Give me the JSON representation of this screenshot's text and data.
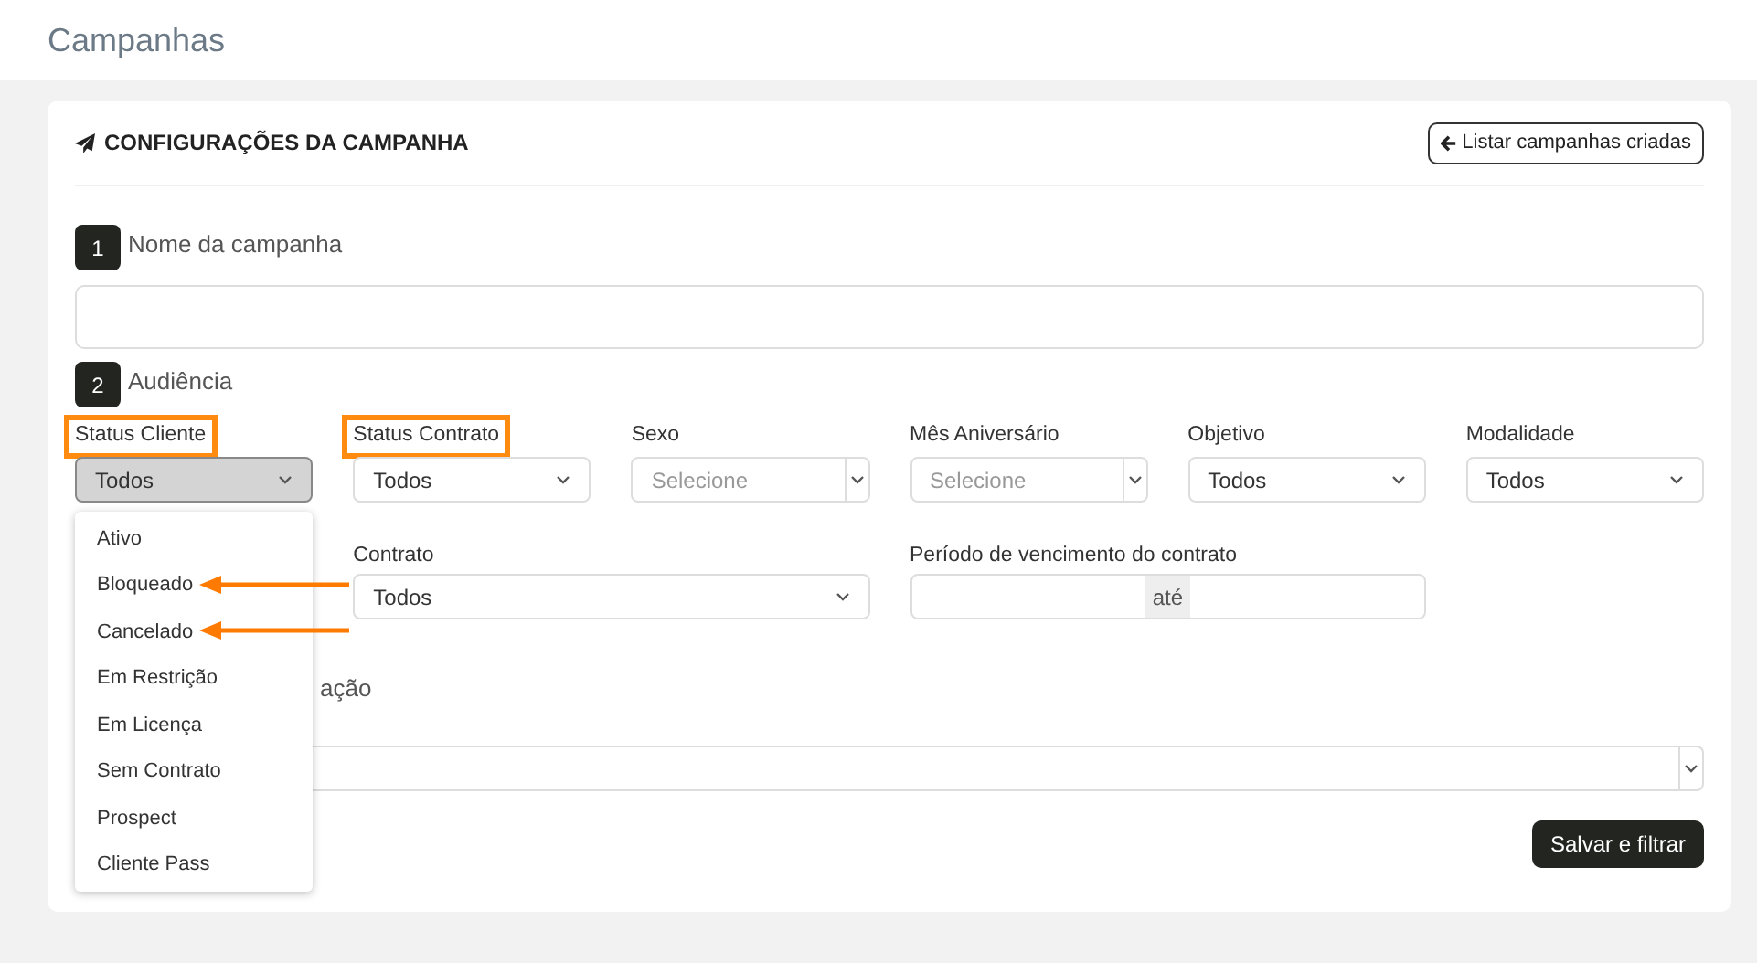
{
  "page_title": "Campanhas",
  "card": {
    "title": "CONFIGURAÇÕES DA CAMPANHA",
    "back_button": "Listar campanhas criadas",
    "step1": {
      "number": "1",
      "label": "Nome da campanha"
    },
    "step2": {
      "number": "2",
      "label": "Audiência"
    },
    "filters": [
      {
        "label": "Status Cliente",
        "kind": "select",
        "value": "Todos",
        "open": true,
        "highlighted": true
      },
      {
        "label": "Status Contrato",
        "kind": "select",
        "value": "Todos",
        "open": false,
        "highlighted": true
      },
      {
        "label": "Sexo",
        "kind": "multiselect",
        "placeholder": "Selecione",
        "open": false,
        "highlighted": false
      },
      {
        "label": "Mês Aniversário",
        "kind": "multiselect",
        "placeholder": "Selecione",
        "open": false,
        "highlighted": false
      },
      {
        "label": "Objetivo",
        "kind": "select",
        "value": "Todos",
        "open": false,
        "highlighted": false
      },
      {
        "label": "Modalidade",
        "kind": "select",
        "value": "Todos",
        "open": false,
        "highlighted": false
      }
    ],
    "filters_row2": [
      {
        "label": "Contrato",
        "kind": "select",
        "value": "Todos"
      },
      {
        "label": "Período de vencimento do contrato",
        "kind": "range",
        "separator": "até"
      }
    ],
    "step3": {
      "label_visible": "ação"
    },
    "dropdown_options": [
      {
        "label": "Ativo",
        "arrow": false
      },
      {
        "label": "Bloqueado",
        "arrow": true
      },
      {
        "label": "Cancelado",
        "arrow": true
      },
      {
        "label": "Em Restrição",
        "arrow": false
      },
      {
        "label": "Em Licença",
        "arrow": false
      },
      {
        "label": "Sem Contrato",
        "arrow": false
      },
      {
        "label": "Prospect",
        "arrow": false
      },
      {
        "label": "Cliente Pass",
        "arrow": false
      }
    ],
    "save_button": "Salvar e filtrar"
  }
}
